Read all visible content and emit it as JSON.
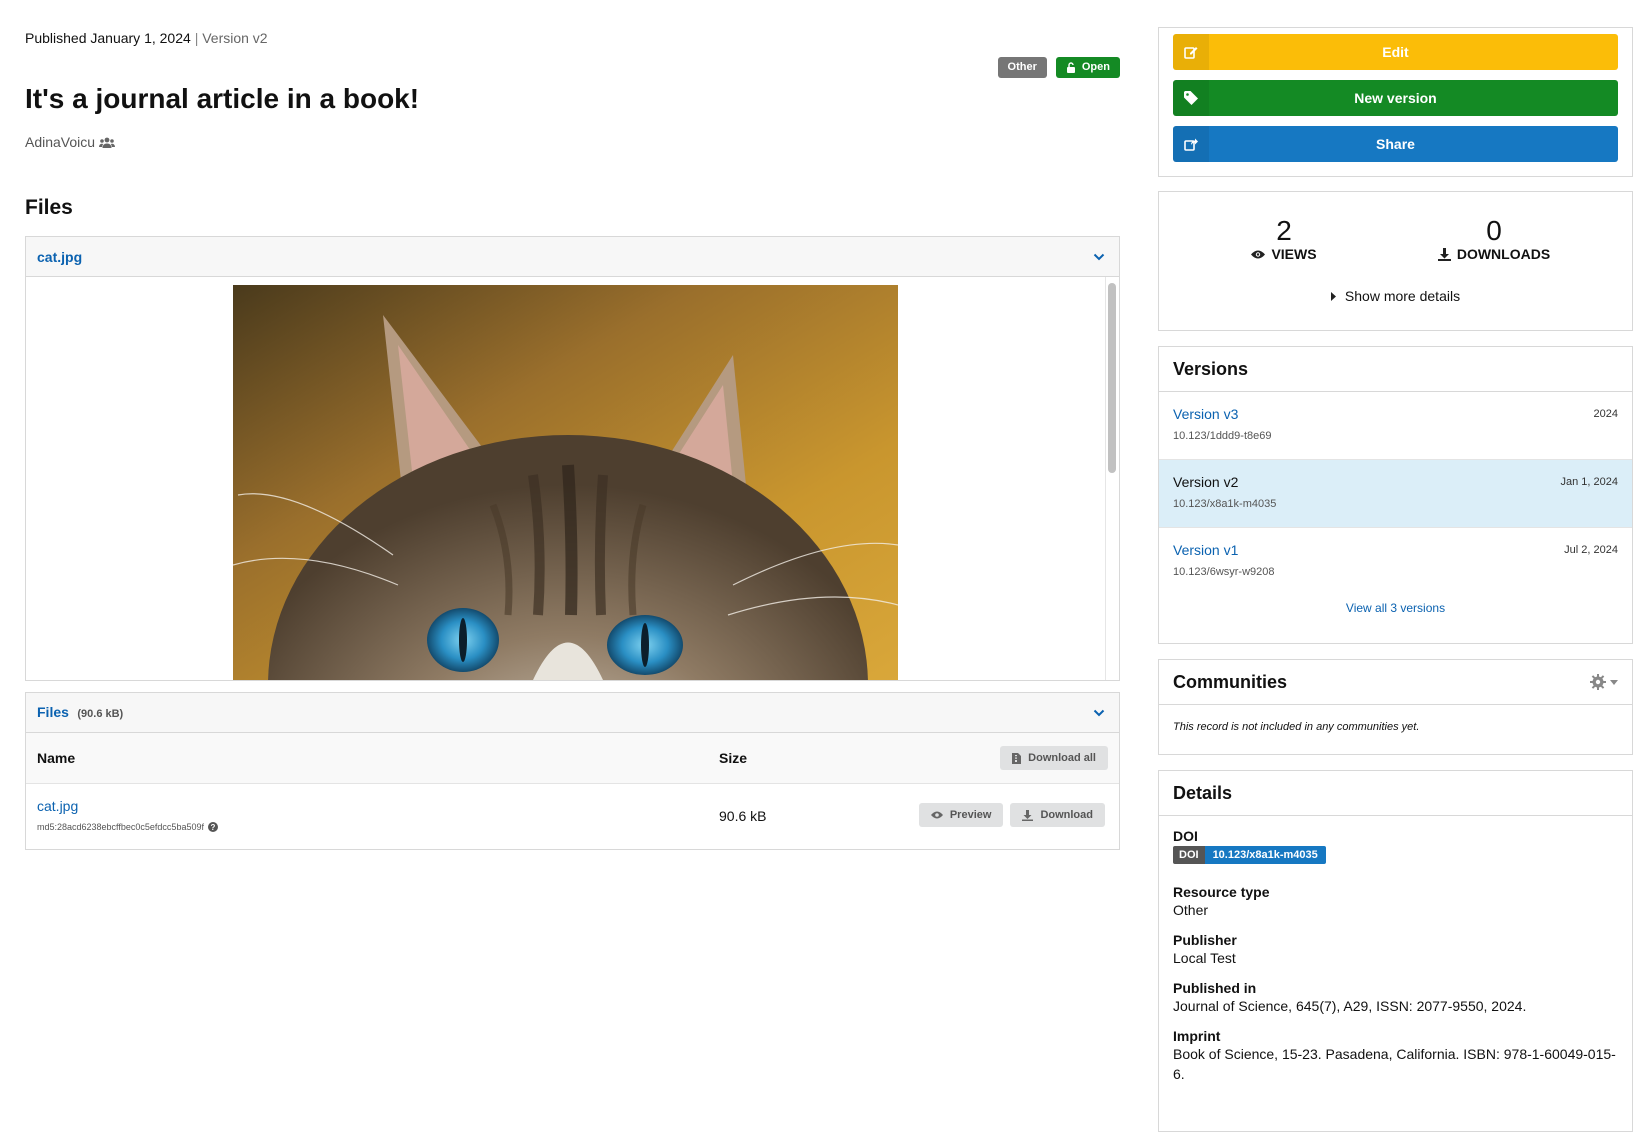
{
  "record": {
    "published": "Published January 1, 2024",
    "separator": "|",
    "version": "Version v2",
    "title": "It's a journal article in a book!",
    "creator": "AdinaVoicu",
    "resource_label": "Other",
    "access_label": "Open"
  },
  "files_section": {
    "heading": "Files",
    "preview_filename": "cat.jpg",
    "files_panel_title": "Files",
    "files_panel_size": "(90.6 kB)",
    "col_name": "Name",
    "col_size": "Size",
    "download_all_label": "Download all",
    "rows": [
      {
        "name": "cat.jpg",
        "md5": "md5:28acd6238ebcffbec0c5efdcc5ba509f",
        "size": "90.6 kB",
        "preview_label": "Preview",
        "download_label": "Download"
      }
    ]
  },
  "actions": {
    "edit": "Edit",
    "new_version": "New version",
    "share": "Share"
  },
  "stats": {
    "views_count": "2",
    "views_label": "VIEWS",
    "downloads_count": "0",
    "downloads_label": "DOWNLOADS",
    "show_more": "Show more details"
  },
  "versions": {
    "heading": "Versions",
    "items": [
      {
        "name": "Version v3",
        "date": "2024",
        "doi": "10.123/1ddd9-t8e69"
      },
      {
        "name": "Version v2",
        "date": "Jan 1, 2024",
        "doi": "10.123/x8a1k-m4035"
      },
      {
        "name": "Version v1",
        "date": "Jul 2, 2024",
        "doi": "10.123/6wsyr-w9208"
      }
    ],
    "view_all": "View all 3 versions"
  },
  "communities": {
    "heading": "Communities",
    "empty_text": "This record is not included in any communities yet."
  },
  "details": {
    "heading": "Details",
    "doi_label": "DOI",
    "doi_badge_key": "DOI",
    "doi_value": "10.123/x8a1k-m4035",
    "resource_type_label": "Resource type",
    "resource_type_value": "Other",
    "publisher_label": "Publisher",
    "publisher_value": "Local Test",
    "published_in_label": "Published in",
    "published_in_value": "Journal of Science, 645(7), A29, ISSN: 2077-9550, 2024.",
    "imprint_label": "Imprint",
    "imprint_value": "Book of Science, 15-23. Pasadena, California. ISBN: 978-1-60049-015-6."
  },
  "colors": {
    "edit": "#fbbd08",
    "new_version": "#148a24",
    "share": "#1678c2",
    "link": "#0b62b0",
    "active_version_bg": "#dbeef8"
  }
}
